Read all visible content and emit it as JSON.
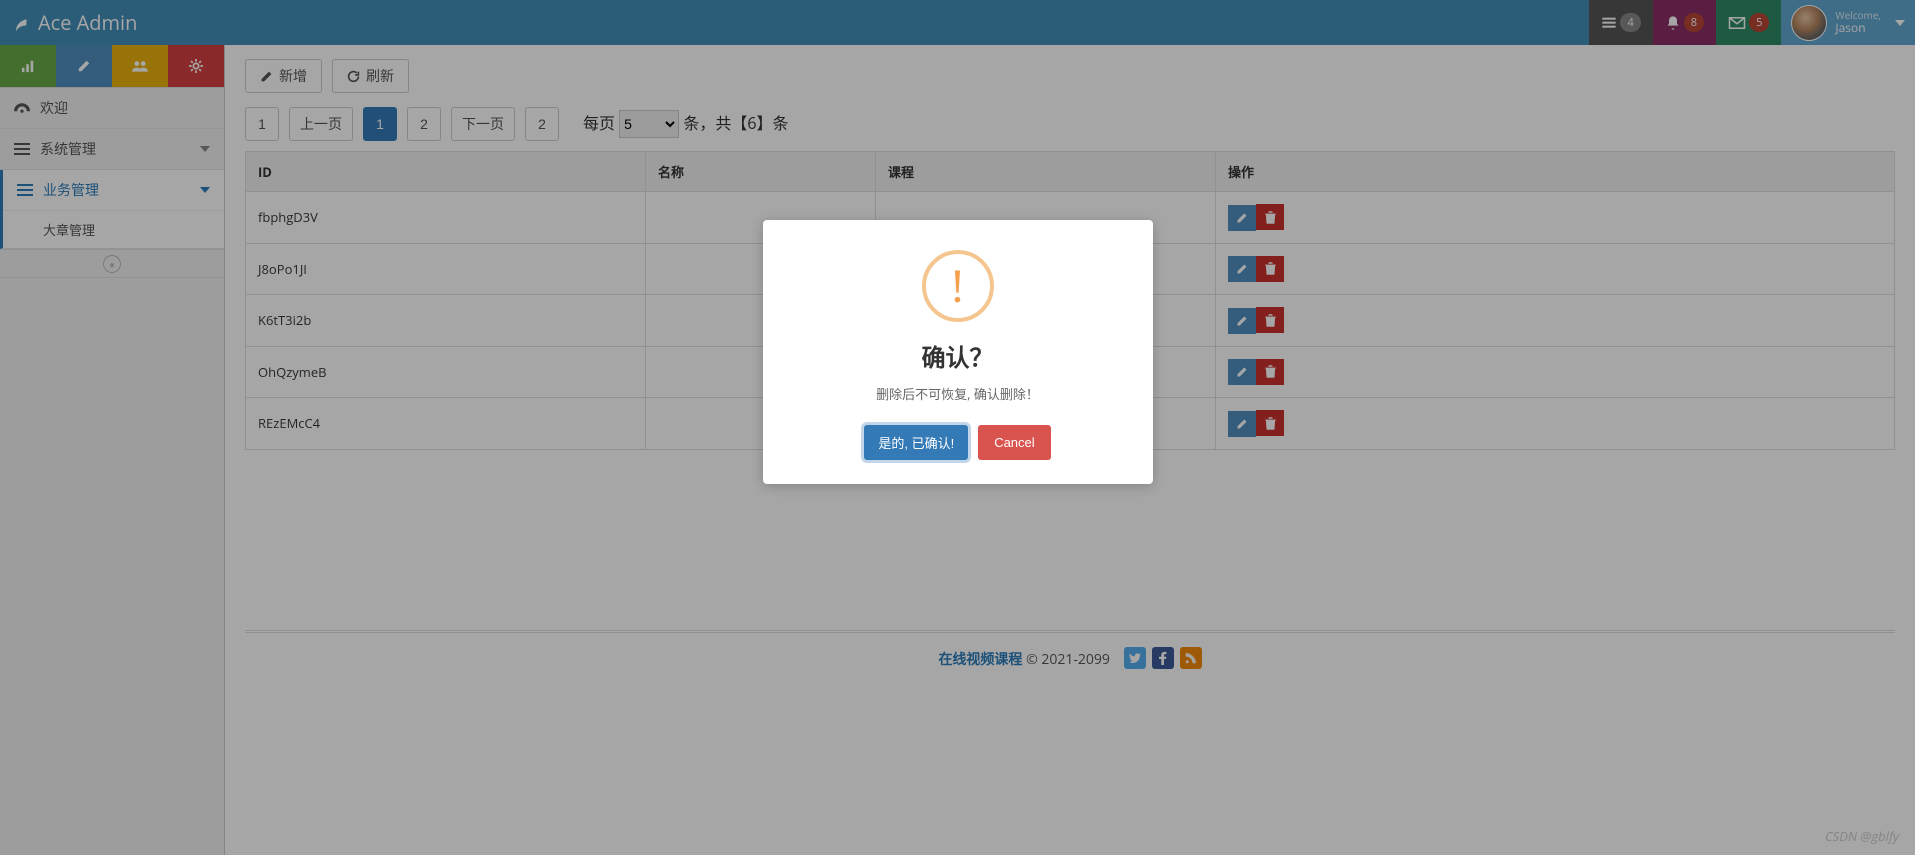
{
  "navbar": {
    "brand": "Ace Admin",
    "tasks_badge": "4",
    "notifications_badge": "8",
    "messages_badge": "5",
    "welcome_small": "Welcome,",
    "welcome_name": "Jason"
  },
  "sidebar": {
    "items": [
      {
        "label": "欢迎"
      },
      {
        "label": "系统管理"
      },
      {
        "label": "业务管理"
      }
    ],
    "submenu": [
      {
        "label": "大章管理"
      }
    ]
  },
  "toolbar": {
    "add_label": "新增",
    "refresh_label": "刷新"
  },
  "pagination": {
    "first": "1",
    "prev": "上一页",
    "page1": "1",
    "page2": "2",
    "next": "下一页",
    "last": "2",
    "per_page_prefix": "每页",
    "per_page_value": "5",
    "per_page_suffix": "条，共【6】条"
  },
  "table": {
    "headers": {
      "id": "ID",
      "name": "名称",
      "course": "课程",
      "action": "操作"
    },
    "rows": [
      {
        "id": "fbphgD3V"
      },
      {
        "id": "J8oPo1JI"
      },
      {
        "id": "K6tT3i2b"
      },
      {
        "id": "OhQzymeB"
      },
      {
        "id": "REzEMcC4"
      }
    ]
  },
  "footer": {
    "brand": "在线视频课程",
    "copyright": "© 2021-2099"
  },
  "modal": {
    "title": "确认？",
    "text": "删除后不可恢复, 确认删除！",
    "confirm": "是的, 已确认!",
    "cancel": "Cancel"
  },
  "watermark": "CSDN @gblfy"
}
